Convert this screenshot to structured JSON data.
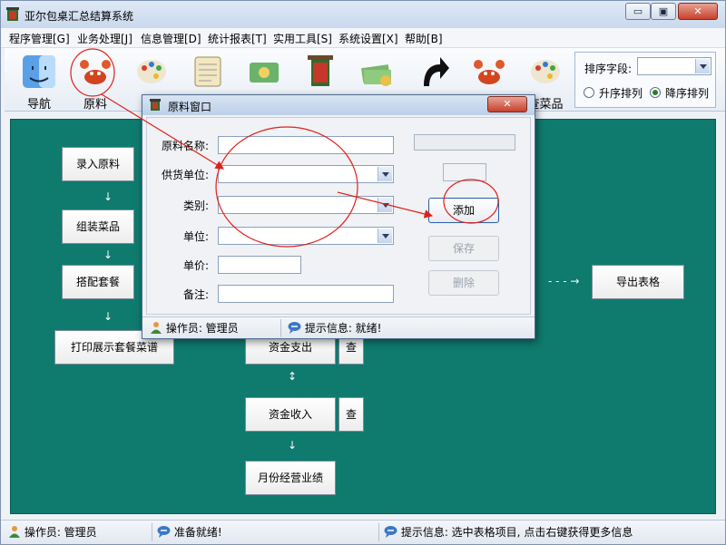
{
  "window": {
    "title": "亚尔包桌汇总结算系统",
    "min_glyph": "▭",
    "max_glyph": "▣",
    "close_glyph": "✕"
  },
  "menu": [
    {
      "label": "程序管理[G]"
    },
    {
      "label": "业务处理[J]"
    },
    {
      "label": "信息管理[D]"
    },
    {
      "label": "统计报表[T]"
    },
    {
      "label": "实用工具[S]"
    },
    {
      "label": "系统设置[X]"
    },
    {
      "label": "帮助[B]"
    }
  ],
  "toolbar": {
    "buttons": [
      {
        "label": "导航",
        "icon": "mac-finder-icon"
      },
      {
        "label": "原料",
        "icon": "crab-icon"
      },
      {
        "label": "",
        "icon": "palette-icon"
      },
      {
        "label": "",
        "icon": "notepad-icon"
      },
      {
        "label": "",
        "icon": "money-icon"
      },
      {
        "label": "",
        "icon": "bun-scroll-icon"
      },
      {
        "label": "",
        "icon": "cash-stack-icon"
      },
      {
        "label": "",
        "icon": "black-arrow-icon"
      },
      {
        "label": "",
        "icon": "crab-icon"
      },
      {
        "label": "查菜品",
        "icon": "palette-icon"
      }
    ]
  },
  "sort": {
    "label": "排序字段:",
    "value": "",
    "asc_label": "升序排列",
    "desc_label": "降序排列",
    "selected": "desc"
  },
  "flow": {
    "enter_material": "录入原料",
    "assemble_dish": "组装菜品",
    "match_set": "搭配套餐",
    "print_menu": "打印展示套餐菜谱",
    "export_table": "导出表格",
    "fund_expense": "资金支出",
    "fund_income": "资金收入",
    "monthly_perf": "月份经营业绩",
    "query_label": "查",
    "down_arrow": "↓",
    "dash_arrow": "- - - →",
    "updown_arrow": "↕"
  },
  "dialog": {
    "title": "原料窗口",
    "close_glyph": "✕",
    "fields": {
      "name_label": "原料名称:",
      "supplier_label": "供货单位:",
      "category_label": "类别:",
      "unit_label": "单位:",
      "price_label": "单价:",
      "remark_label": "备注:"
    },
    "buttons": {
      "add": "添加",
      "save": "保存",
      "delete": "删除"
    },
    "status": {
      "operator": "操作员: 管理员",
      "message": "提示信息: 就绪!"
    }
  },
  "statusbar": {
    "operator": "操作员: 管理员",
    "ready": "准备就绪!",
    "hint": "提示信息: 选中表格项目, 点击右键获得更多信息"
  },
  "colors": {
    "workspace": "#0f7a6e",
    "annotation": "#e0201a",
    "accent": "#2b5ea3"
  }
}
